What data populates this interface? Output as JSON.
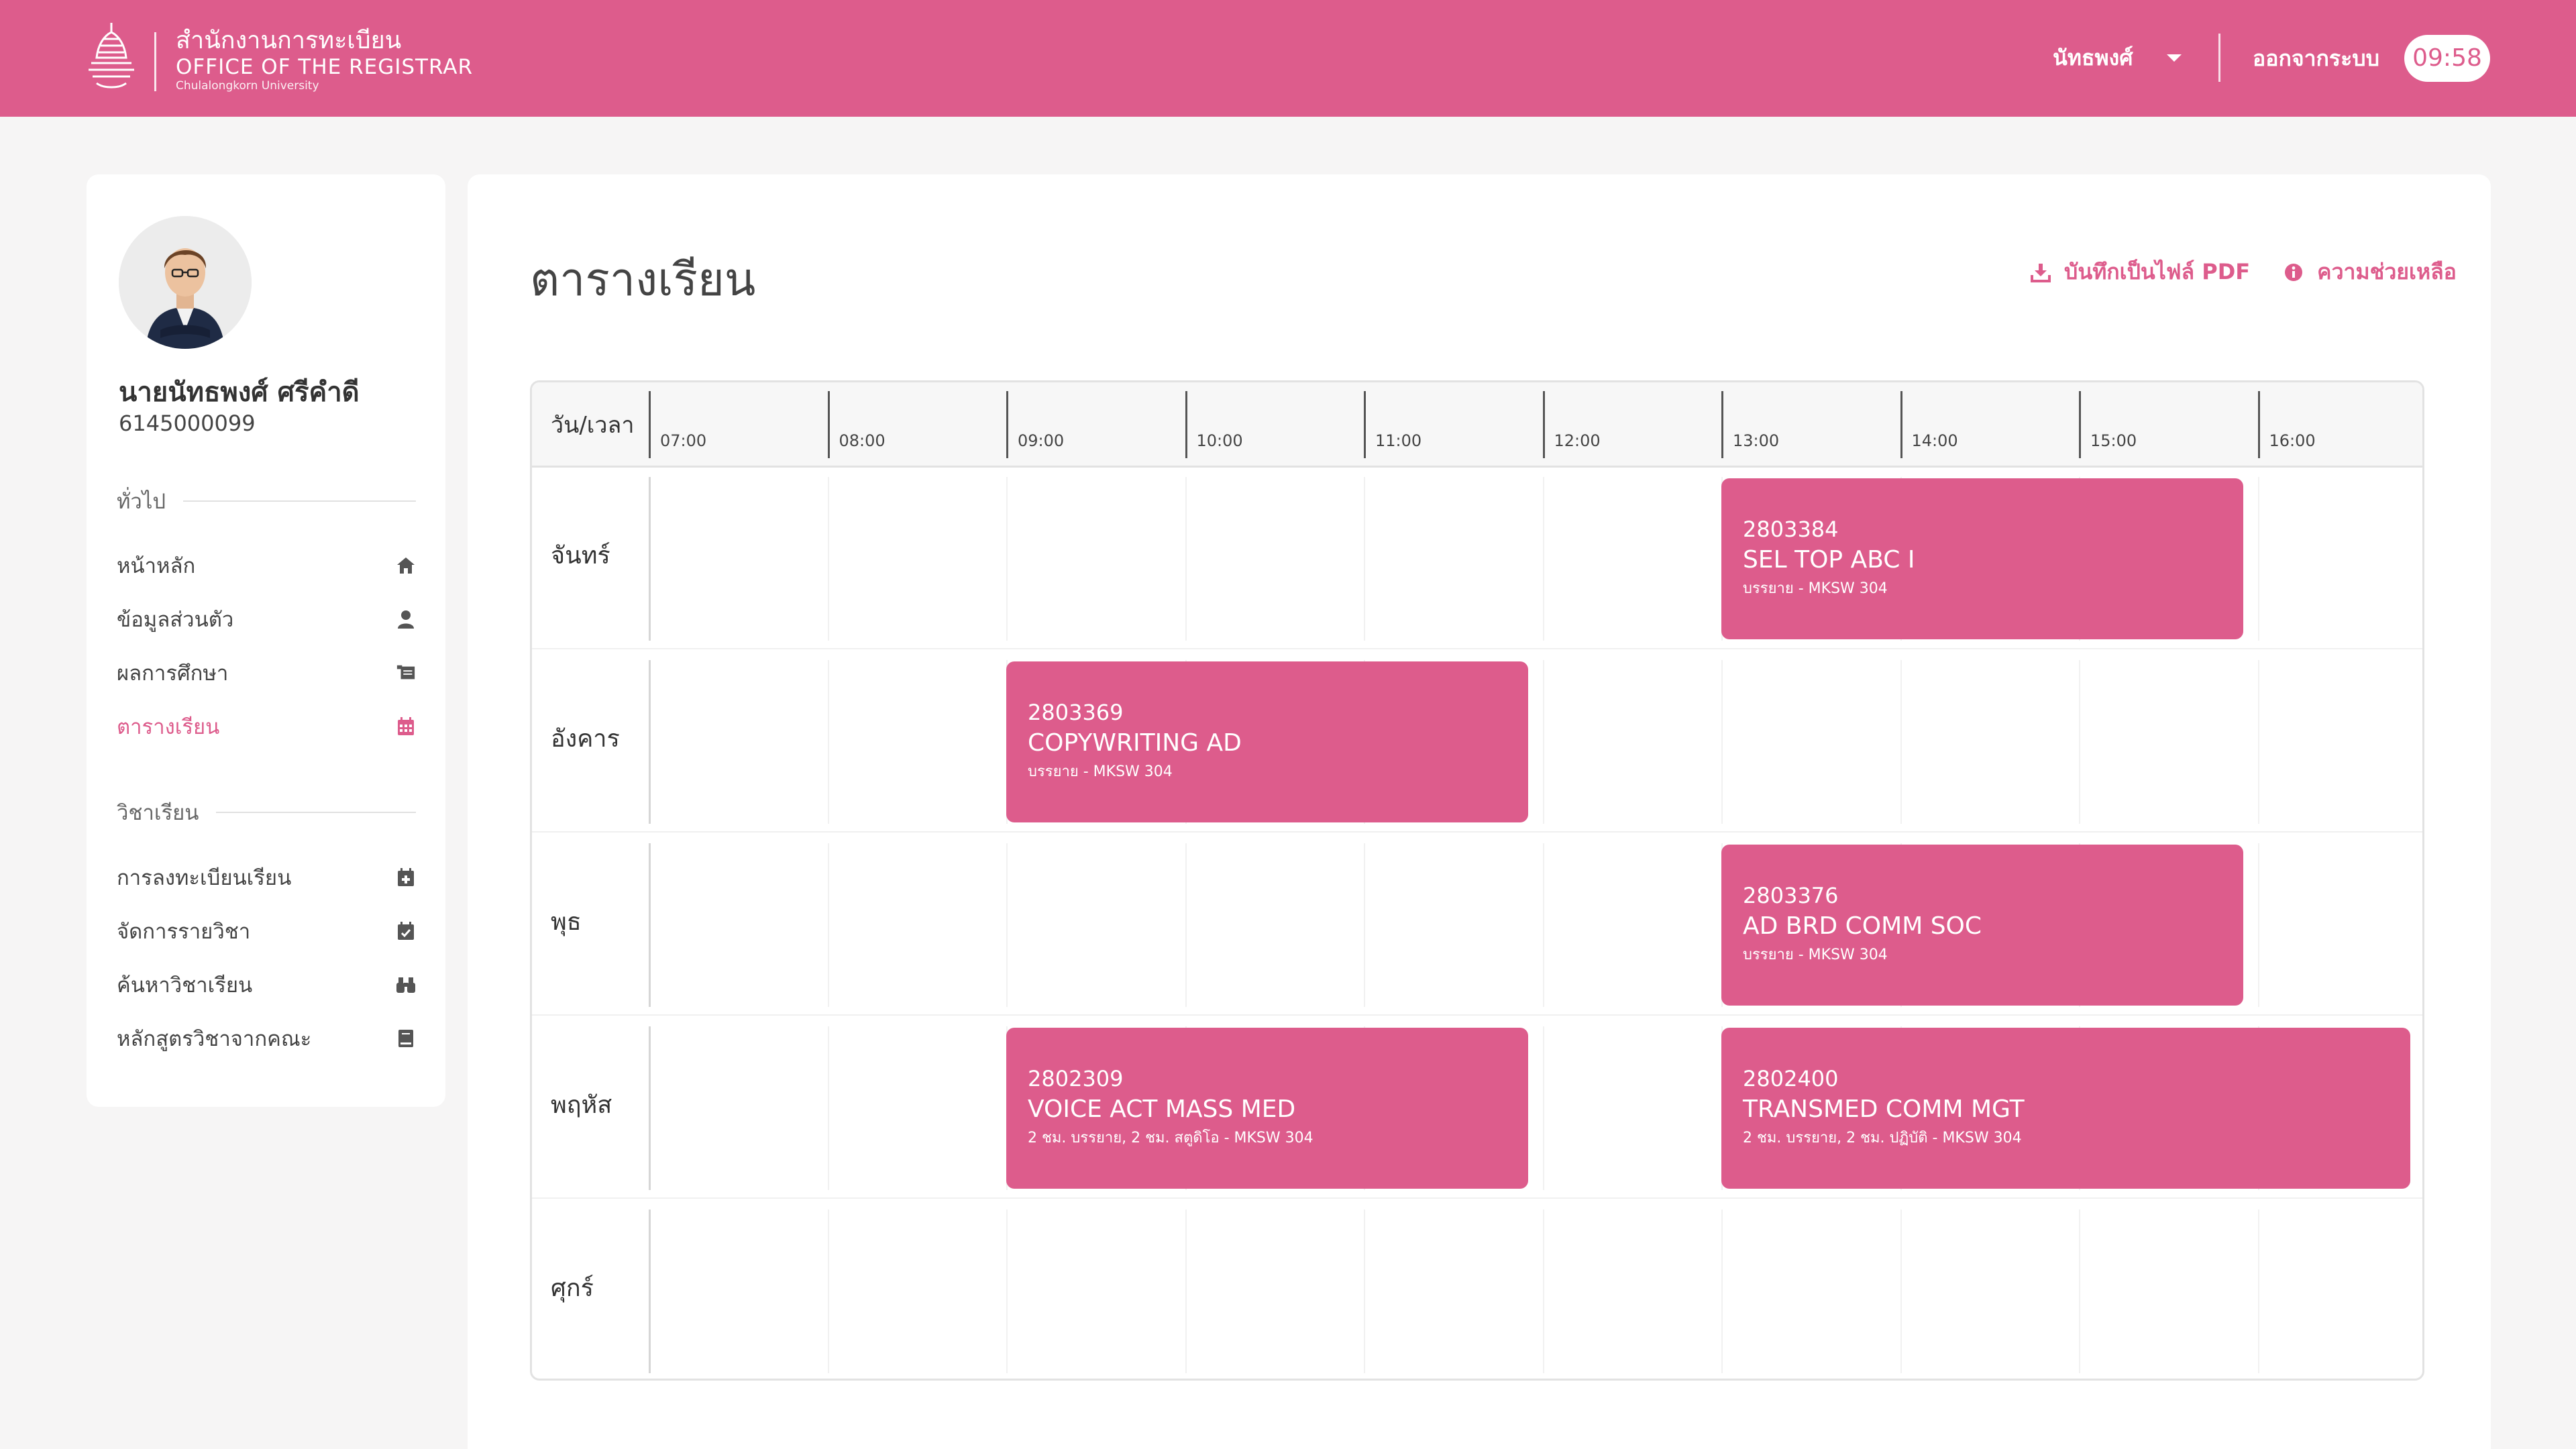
{
  "header": {
    "org_thai": "สำนักงานการทะเบียน",
    "org_en": "OFFICE OF THE REGISTRAR",
    "university": "Chulalongkorn University",
    "user_name": "นัทธพงศ์",
    "logout_label": "ออกจากระบบ",
    "clock": "09:58",
    "brand_color": "#dd5c8c"
  },
  "profile": {
    "name": "นายนัทธพงศ์ ศรีคำดี",
    "student_id": "6145000099"
  },
  "sidebar": {
    "general_title": "ทั่วไป",
    "general_items": [
      {
        "label": "หน้าหลัก",
        "icon": "home-icon"
      },
      {
        "label": "ข้อมูลส่วนตัว",
        "icon": "user-icon"
      },
      {
        "label": "ผลการศึกษา",
        "icon": "grades-icon"
      },
      {
        "label": "ตารางเรียน",
        "icon": "calendar-icon",
        "active": true
      }
    ],
    "course_title": "วิชาเรียน",
    "course_items": [
      {
        "label": "การลงทะเบียนเรียน",
        "icon": "calendar-add-icon"
      },
      {
        "label": "จัดการรายวิชา",
        "icon": "calendar-check-icon"
      },
      {
        "label": "ค้นหาวิชาเรียน",
        "icon": "binoculars-icon"
      },
      {
        "label": "หลักสูตรวิชาจากคณะ",
        "icon": "book-icon"
      }
    ]
  },
  "main": {
    "title": "ตารางเรียน",
    "save_pdf_label": "บันทึกเป็นไฟล์ PDF",
    "help_label": "ความช่วยเหลือ"
  },
  "timetable": {
    "corner_label": "วัน/เวลา",
    "times": [
      "07:00",
      "08:00",
      "09:00",
      "10:00",
      "11:00",
      "12:00",
      "13:00",
      "14:00",
      "15:00",
      "16:00"
    ],
    "days": [
      "จันทร์",
      "อังคาร",
      "พุธ",
      "พฤหัส",
      "ศุกร์"
    ],
    "classes": [
      {
        "day": 0,
        "start": "13:00",
        "end": "16:00",
        "code": "2803384",
        "name": "SEL TOP ABC I",
        "detail": "บรรยาย - MKSW 304"
      },
      {
        "day": 1,
        "start": "09:00",
        "end": "12:00",
        "code": "2803369",
        "name": "COPYWRITING AD",
        "detail": "บรรยาย - MKSW 304"
      },
      {
        "day": 2,
        "start": "13:00",
        "end": "16:00",
        "code": "2803376",
        "name": "AD BRD COMM SOC",
        "detail": "บรรยาย - MKSW 304"
      },
      {
        "day": 3,
        "start": "09:00",
        "end": "12:00",
        "code": "2802309",
        "name": "VOICE ACT MASS MED",
        "detail": "2 ชม. บรรยาย, 2 ชม. สตูดิโอ - MKSW 304"
      },
      {
        "day": 3,
        "start": "13:00",
        "end": "17:00",
        "code": "2802400",
        "name": "TRANSMED COMM MGT",
        "detail": "2 ชม. บรรยาย, 2 ชม. ปฏิบัติ - MKSW 304"
      }
    ]
  }
}
